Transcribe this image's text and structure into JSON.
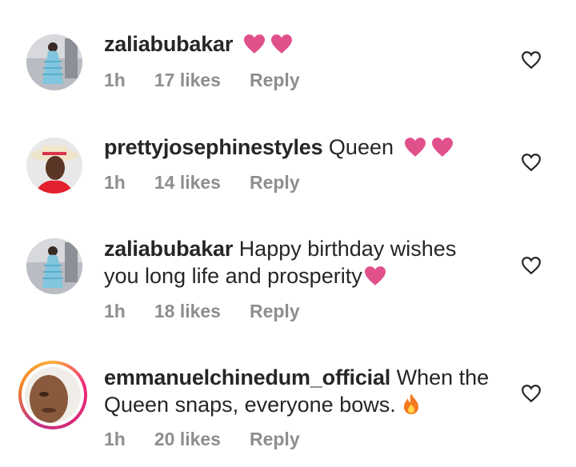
{
  "comments": [
    {
      "username": "zaliabubakar",
      "text": "",
      "emojis": [
        "heart",
        "heart"
      ],
      "time": "1h",
      "likes": "17 likes",
      "reply": "Reply"
    },
    {
      "username": "prettyjosephinestyles",
      "text": "Queen",
      "emojis": [
        "heart",
        "heart"
      ],
      "time": "1h",
      "likes": "14 likes",
      "reply": "Reply"
    },
    {
      "username": "zaliabubakar",
      "text": "Happy birthday wishes you long life and prosperity",
      "emojis": [
        "heart"
      ],
      "time": "1h",
      "likes": "18 likes",
      "reply": "Reply"
    },
    {
      "username": "emmanuelchinedum_official",
      "text": "When the Queen snaps, everyone bows.",
      "emojis": [
        "fire"
      ],
      "time": "1h",
      "likes": "20 likes",
      "reply": "Reply"
    }
  ],
  "colors": {
    "heart_emoji": "#e0518c",
    "meta_text": "#8e8e8e",
    "primary_text": "#262626"
  },
  "icons": {
    "like": "heart-outline-icon",
    "emoji_heart": "pink-heart-emoji-icon",
    "emoji_fire": "fire-emoji-icon"
  }
}
